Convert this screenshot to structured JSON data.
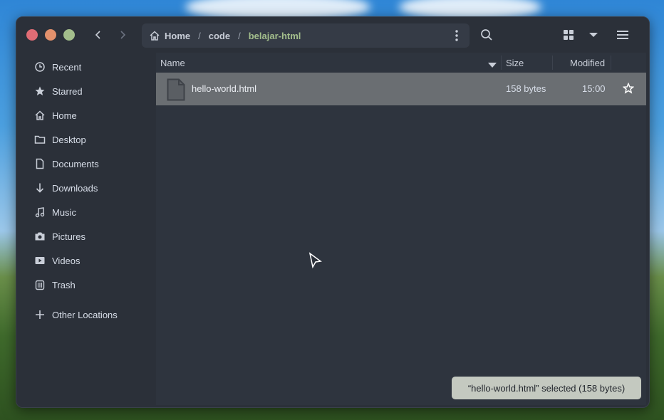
{
  "colors": {
    "window_bg": "#2b3039",
    "accent_green": "#a3be8c",
    "selected_row": "#6a6e72",
    "close": "#e06c75",
    "minimize": "#e3916c",
    "maximize": "#a3be8c"
  },
  "header": {
    "breadcrumbs": [
      {
        "label": "Home",
        "icon": "home-icon"
      },
      {
        "label": "code"
      },
      {
        "label": "belajar-html",
        "active": true
      }
    ],
    "separator": "/",
    "buttons": [
      "back",
      "forward",
      "path-menu",
      "search",
      "grid-view",
      "view-options",
      "main-menu"
    ]
  },
  "sidebar": {
    "items": [
      {
        "label": "Recent",
        "icon": "clock-icon"
      },
      {
        "label": "Starred",
        "icon": "star-icon"
      },
      {
        "label": "Home",
        "icon": "home-icon"
      },
      {
        "label": "Desktop",
        "icon": "folder-icon"
      },
      {
        "label": "Documents",
        "icon": "document-icon"
      },
      {
        "label": "Downloads",
        "icon": "download-icon"
      },
      {
        "label": "Music",
        "icon": "music-icon"
      },
      {
        "label": "Pictures",
        "icon": "camera-icon"
      },
      {
        "label": "Videos",
        "icon": "video-icon"
      },
      {
        "label": "Trash",
        "icon": "trash-icon"
      },
      {
        "label": "Other Locations",
        "icon": "plus-icon"
      }
    ]
  },
  "list": {
    "columns": {
      "name": "Name",
      "size": "Size",
      "modified": "Modified"
    },
    "rows": [
      {
        "name": "hello-world.html",
        "size": "158 bytes",
        "modified": "15:00",
        "icon": "file-icon",
        "starred": false
      }
    ]
  },
  "status": {
    "text": "“hello-world.html” selected  (158 bytes)"
  }
}
